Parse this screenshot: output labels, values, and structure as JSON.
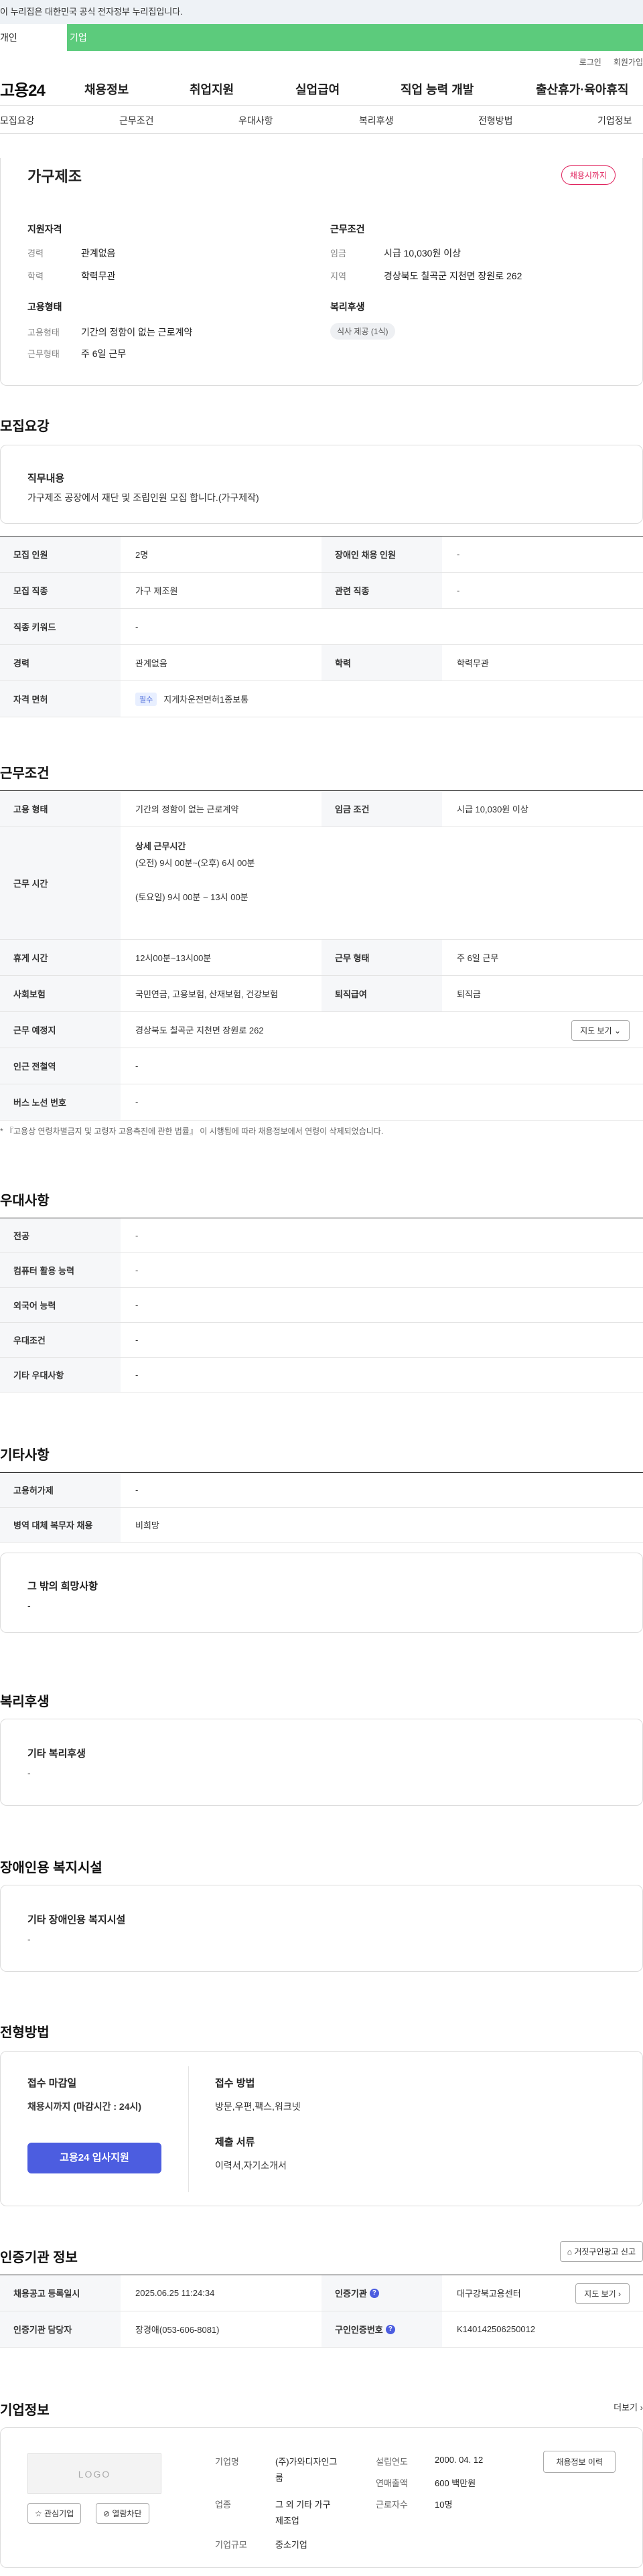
{
  "banner": "이 누리집은 대한민국 공식 전자정부 누리집입니다.",
  "user_tabs": [
    "개인",
    "기업"
  ],
  "util": [
    "로그인",
    "회원가입"
  ],
  "logo": "고용24",
  "gnb": [
    "채용정보",
    "취업지원",
    "실업급여",
    "직업 능력 개발",
    "출산휴가·육아휴직"
  ],
  "anchors": [
    "모집요강",
    "근무조건",
    "우대사항",
    "복리후생",
    "전형방법",
    "기업정보"
  ],
  "summary": {
    "title": "가구제조",
    "badge": "채용시까지",
    "qual_h": "지원자격",
    "qual": [
      {
        "l": "경력",
        "v": "관계없음"
      },
      {
        "l": "학력",
        "v": "학력무관"
      }
    ],
    "emp_h": "고용형태",
    "emp": [
      {
        "l": "고용형태",
        "v": "기간의 정함이 없는 근로계약"
      },
      {
        "l": "근무형태",
        "v": "주 6일 근무"
      }
    ],
    "cond_h": "근무조건",
    "cond": [
      {
        "l": "임금",
        "v": "시급 10,030원 이상"
      },
      {
        "l": "지역",
        "v": "경상북도 칠곡군 지천면 장원로 262"
      }
    ],
    "welfare_h": "복리후생",
    "welfare_chip": "식사 제공 (1식)"
  },
  "recruit": {
    "title": "모집요강",
    "duty_h": "직무내용",
    "duty": "가구제조 공장에서 재단 및 조립인원 모집 합니다.(가구제작)",
    "rows": [
      {
        "a": "모집 인원",
        "av": "2명",
        "b": "장애인 채용 인원",
        "bv": "-"
      },
      {
        "a": "모집 직종",
        "av": "가구 제조원",
        "b": "관련 직종",
        "bv": "-"
      },
      {
        "a": "직종 키워드",
        "av": "-"
      },
      {
        "a": "경력",
        "av": "관계없음",
        "b": "학력",
        "bv": "학력무관"
      },
      {
        "a": "자격 면허",
        "pill": "필수",
        "av": "지게차운전면허1종보통"
      }
    ]
  },
  "work": {
    "title": "근무조건",
    "type_l": "고용 형태",
    "type_v": "기간의 정함이 없는 근로계약",
    "wage_l": "임금 조건",
    "wage_v": "시급 10,030원 이상",
    "hours_l": "근무 시간",
    "hours_h": "상세 근무시간",
    "hours_1": "(오전) 9시 00분~(오후) 6시 00분",
    "hours_2": "(토요일) 9시 00분 ~ 13시 00분",
    "rest_l": "휴게 시간",
    "rest_v": "12시00분~13시00분",
    "form_l": "근무 형태",
    "form_v": "주 6일 근무",
    "ins_l": "사회보험",
    "ins_v": "국민연금, 고용보험, 산재보험, 건강보험",
    "ret_l": "퇴직급여",
    "ret_v": "퇴직금",
    "place_l": "근무 예정지",
    "place_v": "경상북도 칠곡군 지천면 장원로 262",
    "map_btn": "지도 보기",
    "sub_l": "인근 전철역",
    "sub_v": "-",
    "bus_l": "버스 노선 번호",
    "bus_v": "-",
    "note": "* 『고용상 연령차별금지 및 고령자 고용촉진에 관한 법률』 이 시행됨에 따라 채용정보에서 연령이 삭제되었습니다."
  },
  "pref": {
    "title": "우대사항",
    "rows": [
      {
        "l": "전공",
        "v": "-"
      },
      {
        "l": "컴퓨터 활용 능력",
        "v": "-"
      },
      {
        "l": "외국어 능력",
        "v": "-"
      },
      {
        "l": "우대조건",
        "v": "-"
      },
      {
        "l": "기타 우대사항",
        "v": "-"
      }
    ]
  },
  "etc": {
    "title": "기타사항",
    "rows": [
      {
        "l": "고용허가제",
        "v": "-"
      },
      {
        "l": "병역 대체 복무자 채용",
        "v": "비희망"
      }
    ],
    "box_h": "그 밖의 희망사항",
    "box_v": "-"
  },
  "welfare": {
    "title": "복리후생",
    "box_h": "기타 복리후생",
    "box_v": "-"
  },
  "disab": {
    "title": "장애인용 복지시설",
    "box_h": "기타 장애인용 복지시설",
    "box_v": "-"
  },
  "process": {
    "title": "전형방법",
    "deadline_h": "접수 마감일",
    "deadline_v": "채용시까지 (마감시간 : 24시)",
    "method_h": "접수 방법",
    "method_v": "방문,우편,팩스,워크넷",
    "docs_h": "제출 서류",
    "docs_v": "이력서,자기소개서",
    "apply": "고용24 입사지원"
  },
  "cert": {
    "title": "인증기관 정보",
    "report_btn": "거짓구인광고 신고",
    "reg_l": "채용공고 등록일시",
    "reg_v": "2025.06.25 11:24:34",
    "org_l": "인증기관",
    "org_v": "대구강북고용센터",
    "map_btn": "지도 보기",
    "mgr_l": "인증기관 담당자",
    "mgr_v": "장경애(053-606-8081)",
    "no_l": "구인인증번호",
    "no_v": "K140142506250012"
  },
  "company": {
    "title": "기업정보",
    "more": "더보기",
    "logo": "LOGO",
    "fav_btn": "관심기업",
    "block_btn": "열람차단",
    "name_l": "기업명",
    "name_v1": "(주)가와디자인그",
    "name_v2": "룹",
    "biz_l": "업종",
    "biz_v1": "그 외 기타 가구",
    "biz_v2": "제조업",
    "size_l": "기업규모",
    "size_v": "중소기업",
    "year_l": "설립연도",
    "year_v": "2000. 04. 12",
    "sales_l": "연매출액",
    "sales_v": "600 백만원",
    "emp_l": "근로자수",
    "emp_v": "10명",
    "jobs_btn": "채용정보 이력"
  }
}
